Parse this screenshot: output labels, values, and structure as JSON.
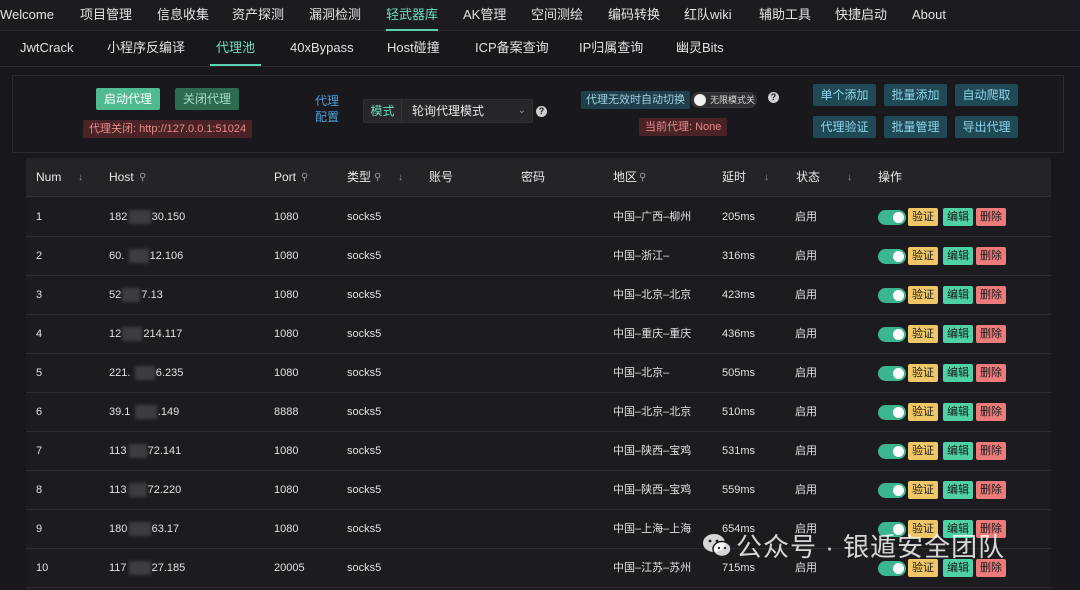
{
  "top_nav": [
    "Welcome",
    "项目管理",
    "信息收集",
    "资产探测",
    "漏洞检测",
    "轻武器库",
    "AK管理",
    "空间测绘",
    "编码转换",
    "红队wiki",
    "辅助工具",
    "快捷启动",
    "About"
  ],
  "sub_nav": [
    "JwtCrack",
    "小程序反编译",
    "代理池",
    "40xBypass",
    "Host碰撞",
    "ICP备案查询",
    "IP归属查询",
    "幽灵Bits"
  ],
  "controls": {
    "start_proxy": "启动代理",
    "stop_proxy": "关闭代理",
    "proxy_status": "代理关闭:   http://127.0.0.1:51024",
    "config_label": "代理\n配置",
    "mode_prefix": "模式",
    "mode_value": "轮询代理模式",
    "auto_switch_label": "代理无效时自动切换",
    "infinite_mode": "无限模式关",
    "current_proxy": "当前代理: None",
    "add_single": "单个添加",
    "add_batch": "批量添加",
    "auto_crawl": "自动爬取",
    "verify_proxy": "代理验证",
    "batch_manage": "批量管理",
    "export_proxy": "导出代理"
  },
  "table": {
    "columns": [
      "Num",
      "Host",
      "Port",
      "类型",
      "账号",
      "密码",
      "地区",
      "延时",
      "状态",
      "操作"
    ],
    "actions": {
      "verify": "验证",
      "edit": "编辑",
      "delete": "删除"
    },
    "rows": [
      {
        "num": "1",
        "host_a": "182",
        "host_b": "30.150",
        "port": "1080",
        "type": "socks5",
        "region": "中国–广西–柳州",
        "delay": "205ms",
        "status": "启用"
      },
      {
        "num": "2",
        "host_a": "60.",
        "host_b": "12.106",
        "port": "1080",
        "type": "socks5",
        "region": "中国–浙江–",
        "delay": "316ms",
        "status": "启用"
      },
      {
        "num": "3",
        "host_a": "52",
        "host_b": "7.13",
        "port": "1080",
        "type": "socks5",
        "region": "中国–北京–北京",
        "delay": "423ms",
        "status": "启用"
      },
      {
        "num": "4",
        "host_a": "12",
        "host_b": "214.117",
        "port": "1080",
        "type": "socks5",
        "region": "中国–重庆–重庆",
        "delay": "436ms",
        "status": "启用"
      },
      {
        "num": "5",
        "host_a": "221.",
        "host_b": "6.235",
        "port": "1080",
        "type": "socks5",
        "region": "中国–北京–",
        "delay": "505ms",
        "status": "启用"
      },
      {
        "num": "6",
        "host_a": "39.1",
        "host_b": ".149",
        "port": "8888",
        "type": "socks5",
        "region": "中国–北京–北京",
        "delay": "510ms",
        "status": "启用"
      },
      {
        "num": "7",
        "host_a": "113",
        "host_b": "72.141",
        "port": "1080",
        "type": "socks5",
        "region": "中国–陕西–宝鸡",
        "delay": "531ms",
        "status": "启用"
      },
      {
        "num": "8",
        "host_a": "113",
        "host_b": "72.220",
        "port": "1080",
        "type": "socks5",
        "region": "中国–陕西–宝鸡",
        "delay": "559ms",
        "status": "启用"
      },
      {
        "num": "9",
        "host_a": "180",
        "host_b": "63.17",
        "port": "1080",
        "type": "socks5",
        "region": "中国–上海–上海",
        "delay": "654ms",
        "status": "启用"
      },
      {
        "num": "10",
        "host_a": "117",
        "host_b": "27.185",
        "port": "20005",
        "type": "socks5",
        "region": "中国–江苏–苏州",
        "delay": "715ms",
        "status": "启用"
      }
    ]
  },
  "watermark": "公众号 · 银遁安全团队"
}
